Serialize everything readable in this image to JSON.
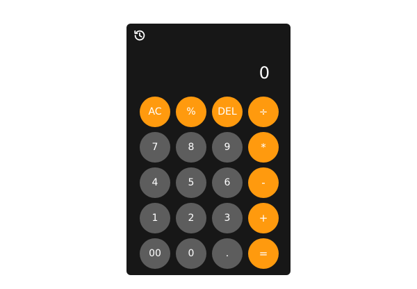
{
  "display": {
    "value": "0"
  },
  "icons": {
    "history": "history-icon"
  },
  "colors": {
    "panel": "#171717",
    "operator": "#ff9a0e",
    "digit": "#5d5d5d",
    "text": "#ffffff"
  },
  "keys": [
    {
      "label": "AC",
      "role": "clear"
    },
    {
      "label": "%",
      "role": "percent"
    },
    {
      "label": "DEL",
      "role": "delete"
    },
    {
      "label": "÷",
      "role": "divide"
    },
    {
      "label": "7",
      "role": "digit"
    },
    {
      "label": "8",
      "role": "digit"
    },
    {
      "label": "9",
      "role": "digit"
    },
    {
      "label": "*",
      "role": "multiply"
    },
    {
      "label": "4",
      "role": "digit"
    },
    {
      "label": "5",
      "role": "digit"
    },
    {
      "label": "6",
      "role": "digit"
    },
    {
      "label": "-",
      "role": "subtract"
    },
    {
      "label": "1",
      "role": "digit"
    },
    {
      "label": "2",
      "role": "digit"
    },
    {
      "label": "3",
      "role": "digit"
    },
    {
      "label": "+",
      "role": "add"
    },
    {
      "label": "00",
      "role": "digit"
    },
    {
      "label": "0",
      "role": "digit"
    },
    {
      "label": ".",
      "role": "decimal"
    },
    {
      "label": "=",
      "role": "equals"
    }
  ]
}
